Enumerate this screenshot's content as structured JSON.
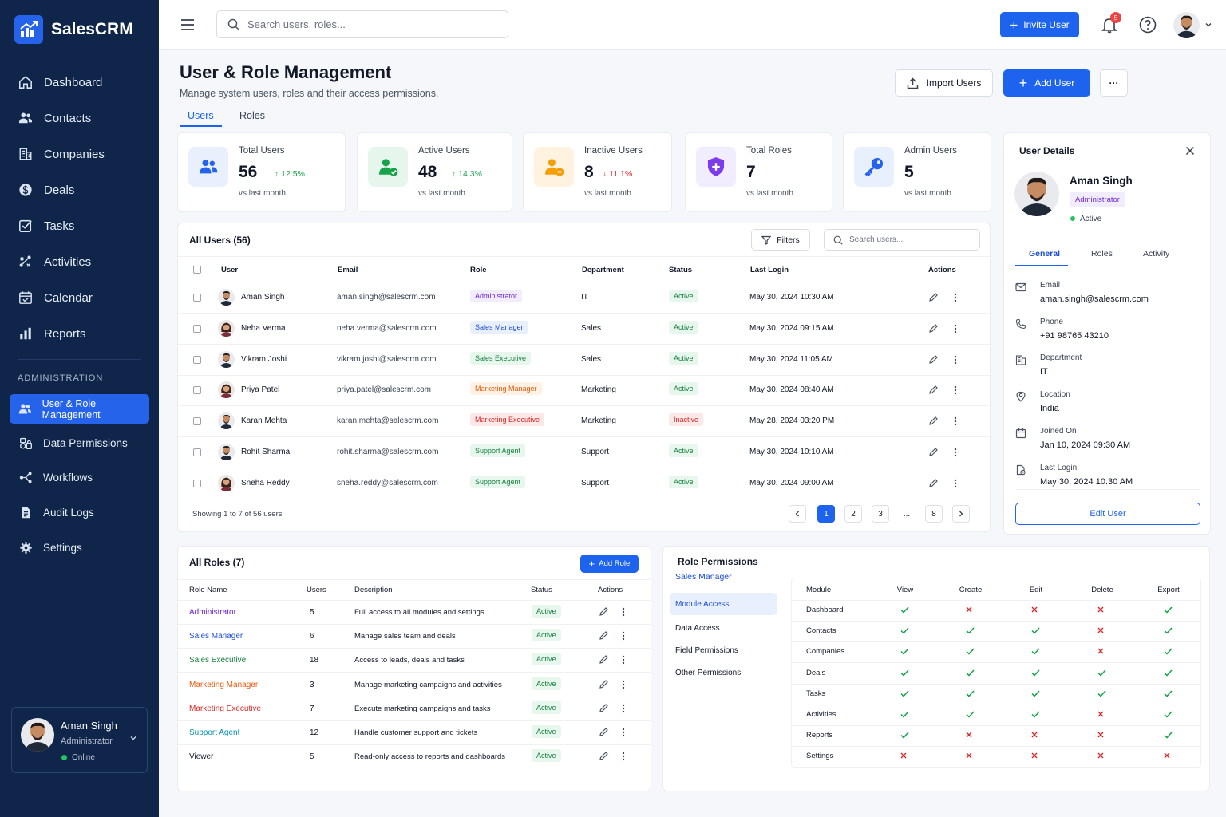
{
  "app": {
    "name": "SalesCRM"
  },
  "sidebar": {
    "items": [
      {
        "label": "Dashboard",
        "icon": "home-icon"
      },
      {
        "label": "Contacts",
        "icon": "users-icon"
      },
      {
        "label": "Companies",
        "icon": "building-icon"
      },
      {
        "label": "Deals",
        "icon": "dollar-icon"
      },
      {
        "label": "Tasks",
        "icon": "checkbox-icon"
      },
      {
        "label": "Activities",
        "icon": "activity-icon"
      },
      {
        "label": "Calendar",
        "icon": "calendar-icon"
      },
      {
        "label": "Reports",
        "icon": "bar-chart-icon"
      }
    ],
    "admin_title": "ADMINISTRATION",
    "admin_items": [
      {
        "label": "User & Role Management",
        "icon": "users-icon",
        "active": true
      },
      {
        "label": "Data Permissions",
        "icon": "shield-icon"
      },
      {
        "label": "Workflows",
        "icon": "workflow-icon"
      },
      {
        "label": "Audit Logs",
        "icon": "document-icon"
      },
      {
        "label": "Settings",
        "icon": "gear-icon"
      }
    ],
    "user": {
      "name": "Aman Singh",
      "role": "Administrator",
      "status": "Online"
    }
  },
  "topbar": {
    "search_placeholder": "Search users, roles...",
    "invite_label": "Invite User",
    "notification_count": "5"
  },
  "page": {
    "title": "User & Role Management",
    "subtitle": "Manage system users, roles and their access permissions.",
    "import_label": "Import Users",
    "add_label": "Add User",
    "more_label": "···",
    "tabs": [
      "Users",
      "Roles"
    ]
  },
  "stats": [
    {
      "title": "Total Users",
      "value": "56",
      "change": "12.5%",
      "dir": "up",
      "sub": "vs last month",
      "color": "#2563eb",
      "bg": "#e8f0fe"
    },
    {
      "title": "Active Users",
      "value": "48",
      "change": "14.3%",
      "dir": "up",
      "sub": "vs last month",
      "color": "#16a34a",
      "bg": "#e6f6ec"
    },
    {
      "title": "Inactive Users",
      "value": "8",
      "change": "11.1%",
      "dir": "down",
      "sub": "vs last month",
      "color": "#f59e0b",
      "bg": "#fff3e0"
    },
    {
      "title": "Total Roles",
      "value": "7",
      "change": "",
      "dir": "",
      "sub": "vs last month",
      "color": "#7c3aed",
      "bg": "#f1ecfe"
    },
    {
      "title": "Admin Users",
      "value": "5",
      "change": "",
      "dir": "",
      "sub": "vs last month",
      "color": "#2563eb",
      "bg": "#e8f0fe"
    }
  ],
  "users_table": {
    "title": "All Users (56)",
    "filters_label": "Filters",
    "search_placeholder": "Search users...",
    "headers": [
      "User",
      "Email",
      "Role",
      "Department",
      "Status",
      "Last Login",
      "Actions"
    ],
    "rows": [
      {
        "name": "Aman Singh",
        "email": "aman.singh@salescrm.com",
        "role": "Administrator",
        "rc": "b-admin",
        "dept": "IT",
        "status": "Active",
        "login": "May 30, 2024 10:30 AM",
        "g": "m"
      },
      {
        "name": "Neha Verma",
        "email": "neha.verma@salescrm.com",
        "role": "Sales Manager",
        "rc": "b-sm",
        "dept": "Sales",
        "status": "Active",
        "login": "May 30, 2024 09:15 AM",
        "g": "f"
      },
      {
        "name": "Vikram Joshi",
        "email": "vikram.joshi@salescrm.com",
        "role": "Sales Executive",
        "rc": "b-se",
        "dept": "Sales",
        "status": "Active",
        "login": "May 30, 2024 11:05 AM",
        "g": "m"
      },
      {
        "name": "Priya Patel",
        "email": "priya.patel@salescrm.com",
        "role": "Marketing Manager",
        "rc": "b-mm",
        "dept": "Marketing",
        "status": "Active",
        "login": "May 30, 2024 08:40 AM",
        "g": "f"
      },
      {
        "name": "Karan Mehta",
        "email": "karan.mehta@salescrm.com",
        "role": "Marketing Executive",
        "rc": "b-me",
        "dept": "Marketing",
        "status": "Inactive",
        "login": "May 28, 2024 03:20 PM",
        "g": "m"
      },
      {
        "name": "Rohit Sharma",
        "email": "rohit.sharma@salescrm.com",
        "role": "Support Agent",
        "rc": "b-sa",
        "dept": "Support",
        "status": "Active",
        "login": "May 30, 2024 10:10 AM",
        "g": "m"
      },
      {
        "name": "Sneha Reddy",
        "email": "sneha.reddy@salescrm.com",
        "role": "Support Agent",
        "rc": "b-sa",
        "dept": "Support",
        "status": "Active",
        "login": "May 30, 2024 09:00 AM",
        "g": "f"
      }
    ],
    "showing": "Showing 1 to 7 of 56 users",
    "pages": [
      "1",
      "2",
      "3",
      "...",
      "8"
    ]
  },
  "roles_table": {
    "title": "All Roles (7)",
    "add_label": "Add Role",
    "headers": [
      "Role Name",
      "Users",
      "Description",
      "Status",
      "Actions"
    ],
    "rows": [
      {
        "name": "Administrator",
        "color": "#6d28d9",
        "users": "5",
        "desc": "Full access to all modules and settings",
        "status": "Active"
      },
      {
        "name": "Sales Manager",
        "color": "#1d4ed8",
        "users": "6",
        "desc": "Manage sales team and deals",
        "status": "Active"
      },
      {
        "name": "Sales Executive",
        "color": "#15803d",
        "users": "18",
        "desc": "Access to leads, deals and tasks",
        "status": "Active"
      },
      {
        "name": "Marketing Manager",
        "color": "#ea580c",
        "users": "3",
        "desc": "Manage marketing campaigns and activities",
        "status": "Active"
      },
      {
        "name": "Marketing Executive",
        "color": "#dc2626",
        "users": "7",
        "desc": "Execute marketing campaigns and tasks",
        "status": "Active"
      },
      {
        "name": "Support Agent",
        "color": "#0891b2",
        "users": "12",
        "desc": "Handle customer support and tickets",
        "status": "Active"
      },
      {
        "name": "Viewer",
        "color": "#111827",
        "users": "5",
        "desc": "Read-only access to reports and dashboards",
        "status": "Active"
      }
    ]
  },
  "permissions": {
    "title": "Role Permissions",
    "role": "Sales Manager",
    "menu": [
      "Module Access",
      "Data Access",
      "Field Permissions",
      "Other Permissions"
    ],
    "headers": [
      "Module",
      "View",
      "Create",
      "Edit",
      "Delete",
      "Export"
    ],
    "rows": [
      {
        "module": "Dashboard",
        "v": [
          1,
          0,
          0,
          0,
          1
        ]
      },
      {
        "module": "Contacts",
        "v": [
          1,
          1,
          1,
          0,
          1
        ]
      },
      {
        "module": "Companies",
        "v": [
          1,
          1,
          1,
          0,
          1
        ]
      },
      {
        "module": "Deals",
        "v": [
          1,
          1,
          1,
          1,
          1
        ]
      },
      {
        "module": "Tasks",
        "v": [
          1,
          1,
          1,
          1,
          1
        ]
      },
      {
        "module": "Activities",
        "v": [
          1,
          1,
          1,
          0,
          1
        ]
      },
      {
        "module": "Reports",
        "v": [
          1,
          0,
          0,
          0,
          1
        ]
      },
      {
        "module": "Settings",
        "v": [
          0,
          0,
          0,
          0,
          0
        ]
      }
    ]
  },
  "user_details": {
    "title": "User Details",
    "name": "Aman Singh",
    "role": "Administrator",
    "status": "Active",
    "tabs": [
      "General",
      "Roles",
      "Activity"
    ],
    "fields": [
      {
        "label": "Email",
        "value": "aman.singh@salescrm.com"
      },
      {
        "label": "Phone",
        "value": "+91 98765 43210"
      },
      {
        "label": "Department",
        "value": "IT"
      },
      {
        "label": "Location",
        "value": "India"
      },
      {
        "label": "Joined On",
        "value": "Jan 10, 2024 09:30 AM"
      },
      {
        "label": "Last Login",
        "value": "May 30, 2024 10:30 AM"
      }
    ],
    "edit_label": "Edit User"
  }
}
